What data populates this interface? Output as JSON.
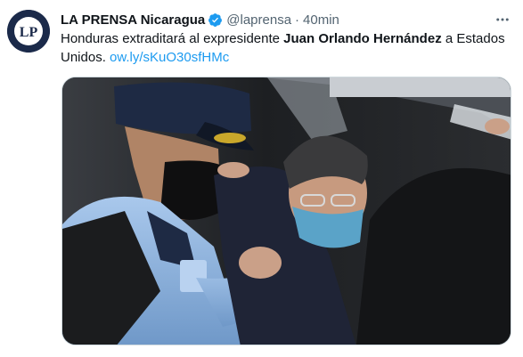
{
  "tweet": {
    "avatar_text": "LP",
    "author_name": "LA PRENSA Nicaragua",
    "handle": "@laprensa",
    "separator": "·",
    "time": "40min",
    "text_before": "Honduras extraditará al expresidente ",
    "text_bold": "Juan Orlando Hernández",
    "text_after": " a Estados Unidos. ",
    "link": "ow.ly/sKuO30sfHMc",
    "more_icon": "more-horizontal-icon"
  },
  "colors": {
    "accent": "#1d9bf0",
    "secondary_text": "#536471",
    "avatar_bg": "#1b2a4a"
  }
}
